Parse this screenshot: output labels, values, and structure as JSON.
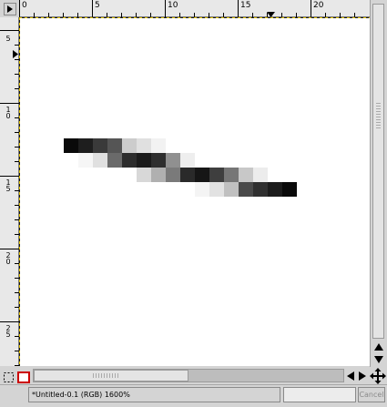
{
  "rulers": {
    "horizontal_labels": [
      {
        "text": "0"
      },
      {
        "text": "5"
      },
      {
        "text": "10"
      },
      {
        "text": "15"
      },
      {
        "text": "20"
      }
    ],
    "vertical_labels": [
      {
        "text": "5"
      },
      {
        "text": "10"
      },
      {
        "text": "15"
      },
      {
        "text": "20"
      },
      {
        "text": "25"
      }
    ]
  },
  "canvas": {
    "background": "#ffffff",
    "pixels": [
      [
        "#0a0a0a",
        "#1e1e1e",
        "#3a3a3a",
        "#555555",
        "#cccccc",
        "#e0e0e0",
        "#f2f2f2",
        "",
        "",
        "",
        "",
        "",
        "",
        "",
        "",
        ""
      ],
      [
        "",
        "#f6f6f6",
        "#e0e0e0",
        "#6a6a6a",
        "#2c2c2c",
        "#1a1a1a",
        "#2e2e2e",
        "#909090",
        "#eeeeee",
        "",
        "",
        "",
        "",
        "",
        "",
        ""
      ],
      [
        "",
        "",
        "",
        "",
        "",
        "#d8d8d8",
        "#b0b0b0",
        "#7a7a7a",
        "#2a2a2a",
        "#161616",
        "#3e3e3e",
        "#767676",
        "#c8c8c8",
        "#ececec",
        "",
        ""
      ],
      [
        "",
        "",
        "",
        "",
        "",
        "",
        "",
        "",
        "",
        "#f4f4f4",
        "#e2e2e2",
        "#c0c0c0",
        "#4a4a4a",
        "#303030",
        "#1c1c1c",
        "#0a0a0a"
      ]
    ]
  },
  "statusbar": {
    "image_label": "*Untitled-0.1 (RGB) 1600%",
    "cancel_label": "Cancel"
  }
}
